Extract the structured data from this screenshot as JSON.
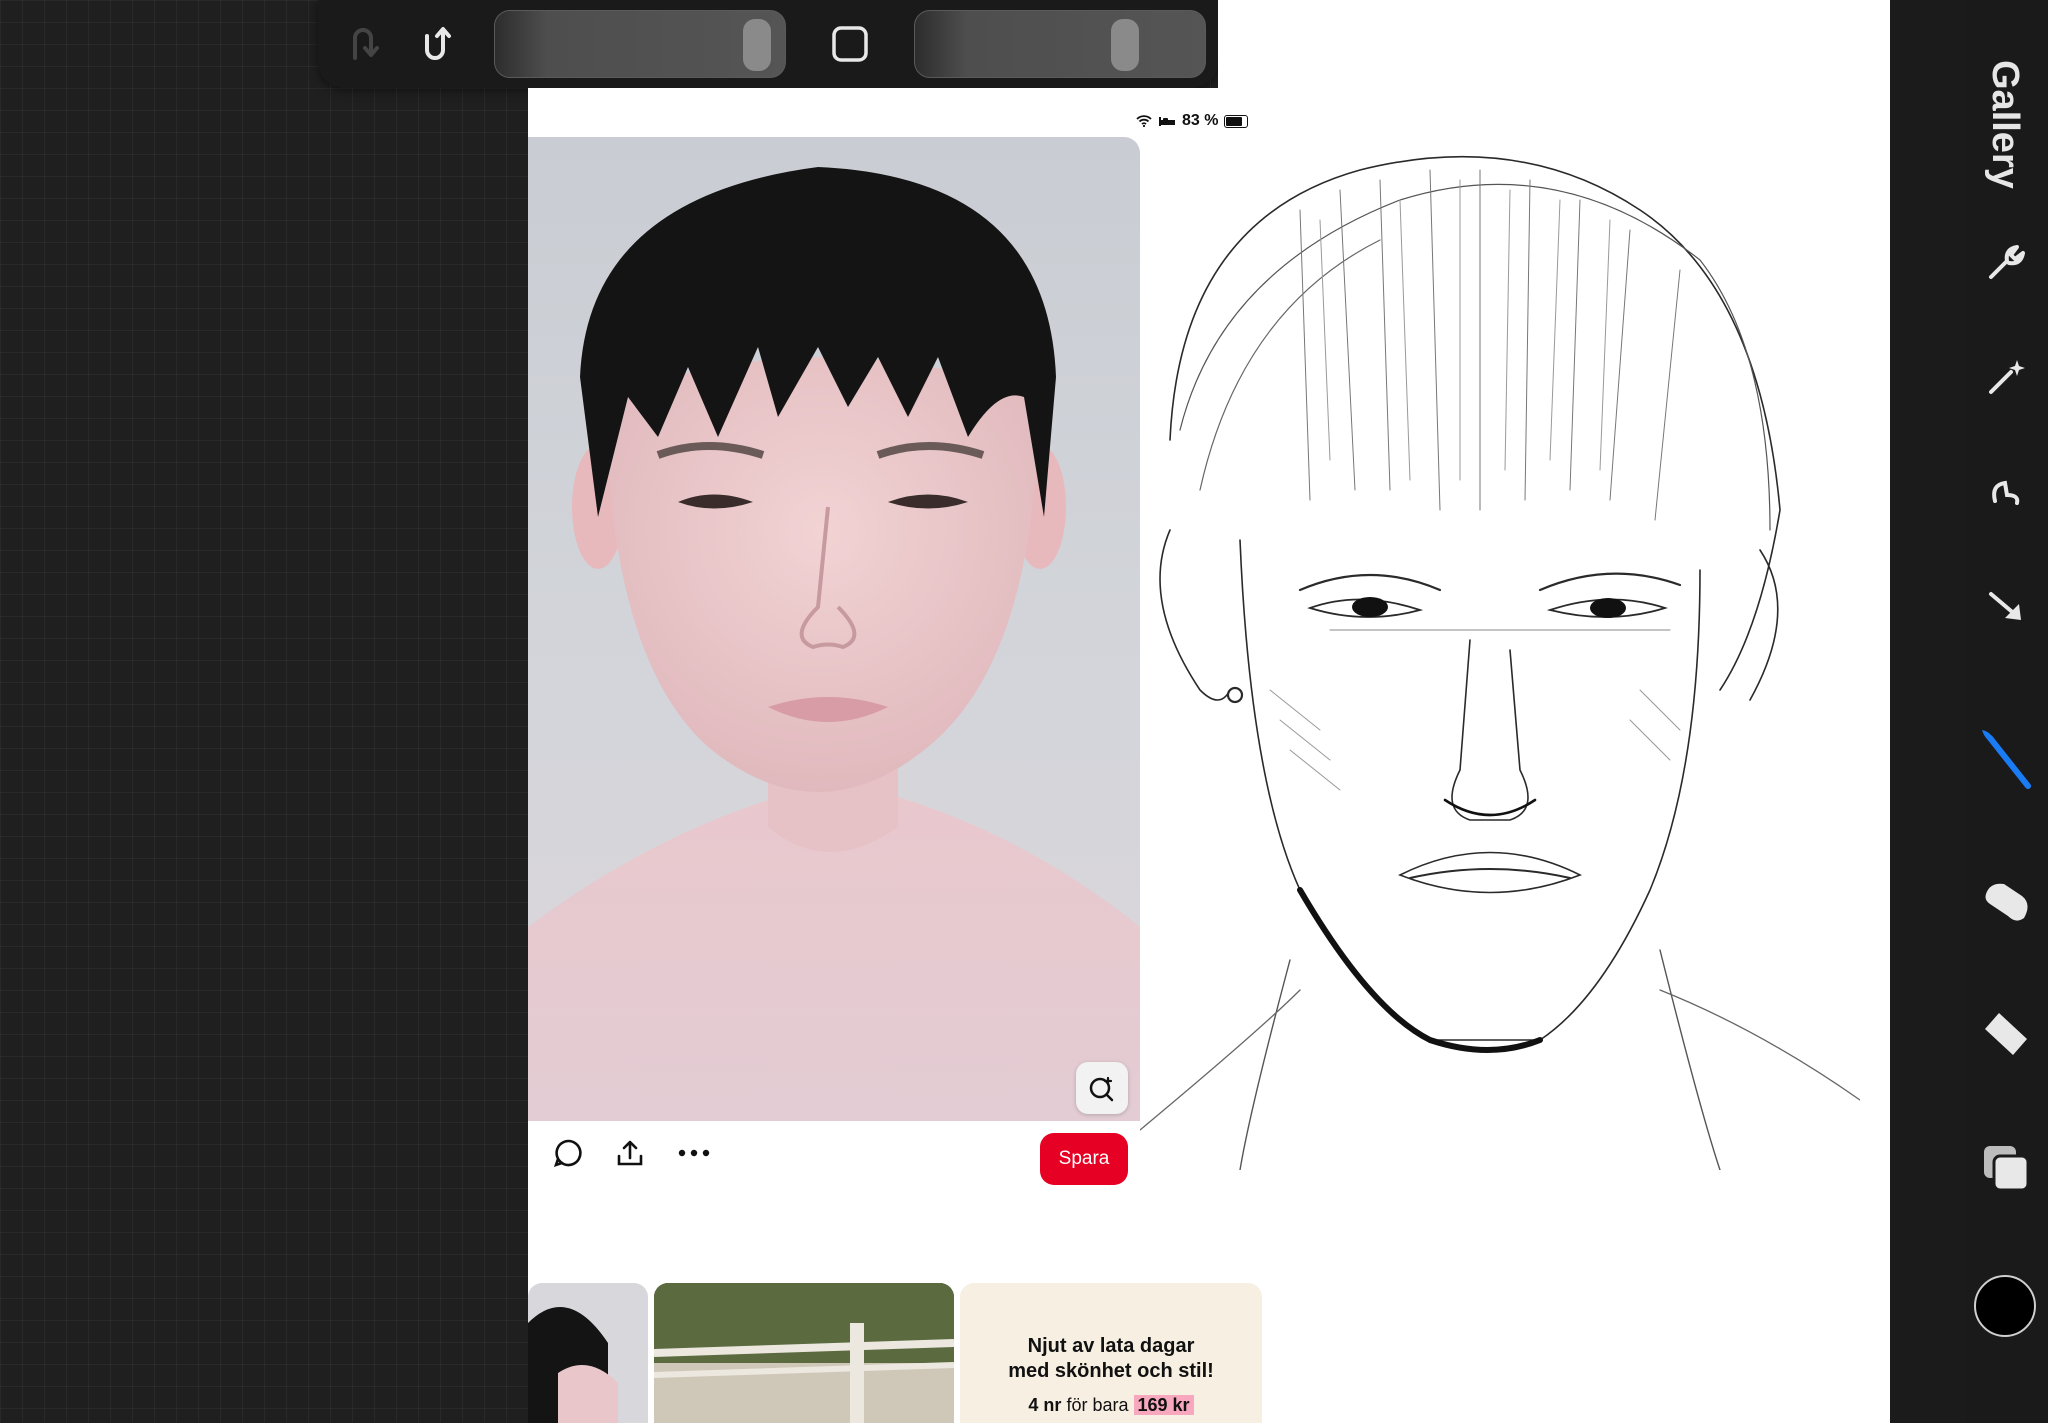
{
  "app": {
    "gallery_label": "Gallery",
    "brush_color": "#000000",
    "accent_color": "#1a7cf5"
  },
  "status_bar": {
    "battery_percent": "83 %"
  },
  "toolbar": {
    "undo_icon": "undo-icon",
    "redo_icon": "redo-icon",
    "brush_size_icon": "slider",
    "modify_icon": "square-icon",
    "opacity_icon": "slider"
  },
  "pin": {
    "save_label": "Spara",
    "save_color": "#e60023",
    "icons": [
      "comment-icon",
      "share-icon",
      "more-icon",
      "visual-search-icon"
    ]
  },
  "ad": {
    "line1": "Njut av lata dagar",
    "line2": "med skönhet och stil!",
    "count": "4 nr",
    "middle": "för bara",
    "price": "169 kr"
  },
  "tools": [
    "wrench-icon",
    "magic-wand-icon",
    "selection-icon",
    "transform-arrow-icon",
    "brush-icon",
    "smudge-icon",
    "eraser-icon",
    "layers-icon"
  ]
}
